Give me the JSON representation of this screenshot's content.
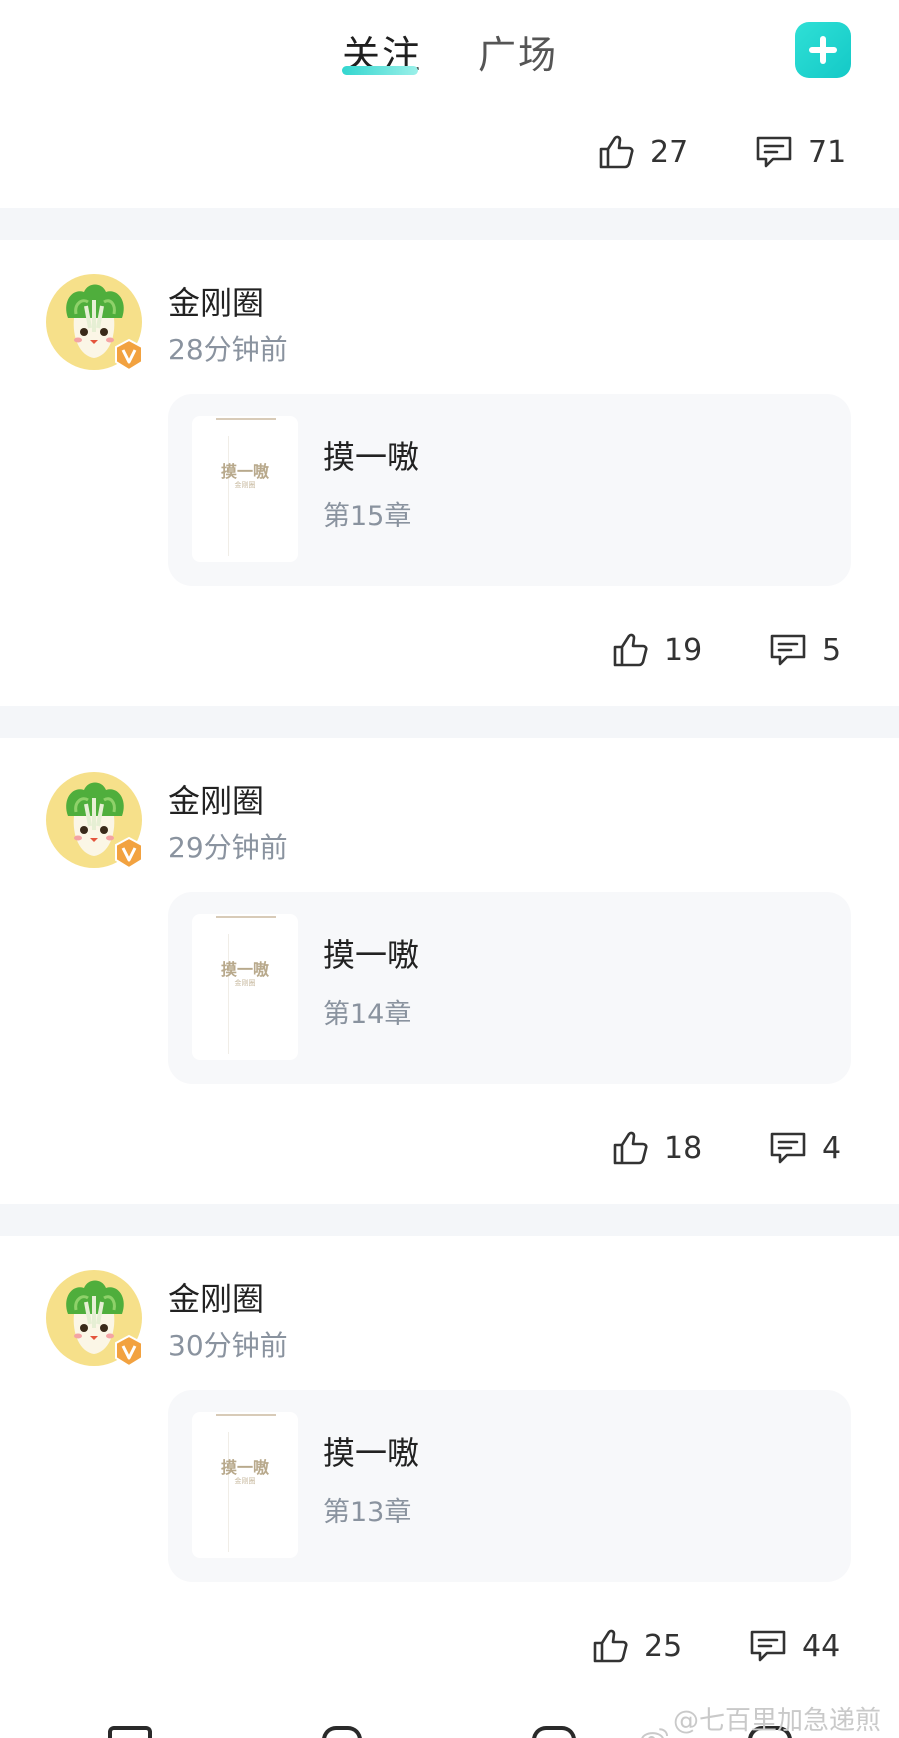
{
  "header": {
    "tabs": [
      {
        "label": "关注",
        "active": true
      },
      {
        "label": "广场",
        "active": false
      }
    ],
    "accent_color": "#1FD2CC"
  },
  "top_actions": {
    "likes": "27",
    "comments": "71"
  },
  "posts": [
    {
      "author": "金刚圈",
      "time": "28分钟前",
      "book": {
        "cover_title": "摸一嗷",
        "cover_sub": "金刚圈",
        "title": "摸一嗷",
        "chapter": "第15章"
      },
      "likes": "19",
      "comments": "5"
    },
    {
      "author": "金刚圈",
      "time": "29分钟前",
      "book": {
        "cover_title": "摸一嗷",
        "cover_sub": "金刚圈",
        "title": "摸一嗷",
        "chapter": "第14章"
      },
      "likes": "18",
      "comments": "4"
    },
    {
      "author": "金刚圈",
      "time": "30分钟前",
      "book": {
        "cover_title": "摸一嗷",
        "cover_sub": "金刚圈",
        "title": "摸一嗷",
        "chapter": "第13章"
      },
      "likes": "25",
      "comments": "44"
    }
  ],
  "watermark": "@七百里加急递煎饼",
  "icons": {
    "like": "thumbs-up-icon",
    "comment": "comment-bubble-icon",
    "add": "plus-icon",
    "verified": "verified-v-badge-icon",
    "avatar": "cabbage-mascot-avatar"
  }
}
